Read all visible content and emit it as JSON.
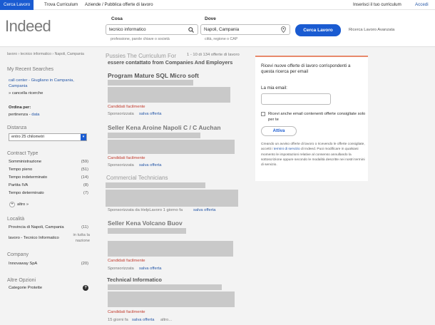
{
  "topnav": {
    "tabs": [
      "Cerca Lavoro",
      "Trova Curriculum",
      "Aziende / Pubblica offerte di lavoro"
    ],
    "insert_cv": "Inserisci il tuo curriculum",
    "login": "Accedi"
  },
  "header": {
    "logo": "Indeed",
    "what_label": "Cosa",
    "what_value": "tecnico informatico",
    "what_hint": "professione, parole chiave o società",
    "where_label": "Dove",
    "where_value": "Napoli, Campania",
    "where_hint": "città, regione o CAP",
    "find_button": "Cerca Lavoro",
    "advanced": "Ricerca Lavoro Avanzata"
  },
  "breadcrumb": "lavoro › tecnico informatico › Napoli, Campania",
  "sidebar": {
    "recent_title": "My Recent Searches",
    "recent_item": "call center - Giugliano in Campania, Campania",
    "clear": "» cancella ricerche",
    "sort_label": "Ordina per:",
    "sort_active": "pertinenza",
    "sort_sep": " - ",
    "sort_other": "data",
    "distance_title": "Distanza",
    "distance_value": "entro 25 chilometri",
    "contract_title": "Contract Type",
    "contract_items": [
      {
        "label": "Somministrazione",
        "count": "(59)"
      },
      {
        "label": "Tempo pieno",
        "count": "(51)"
      },
      {
        "label": "Tempo indeterminato",
        "count": "(14)"
      },
      {
        "label": "Partita IVA",
        "count": "(8)"
      },
      {
        "label": "Tempo determinato",
        "count": "(7)"
      }
    ],
    "more": "altro »",
    "location_title": "Località",
    "location_item": "Provincia di Napoli, Campania",
    "location_count": "(11)",
    "location_sub": "lavoro - Tecnico Informatico",
    "location_sub2": "in tutta la nazione",
    "company_title": "Company",
    "company_item": "Innovaway SpA",
    "company_count": "(20)",
    "other_title": "Altre Opzioni",
    "protected": "Categorie Protette"
  },
  "results": {
    "overlay_title": "Pussies The Curriculum For",
    "count": "1 - 10 di 134 offerte di lavoro",
    "overlay_sub": "essere contattato from Companies And Employers",
    "easy_apply": "Candidati facilmente",
    "sponsored": "Sponsorizzata",
    "save": "salva offerta",
    "jobs": [
      {
        "title": "Program Mature SQL Micro soft"
      },
      {
        "title": "Seller Kena Aroine Napoli C / C Auchan"
      },
      {
        "title": "Commercial Technicians",
        "meta": "Sponsorizzata da HelpLavoro  1 giorno fa"
      },
      {
        "title": "Seller Kena Volcano Buov"
      },
      {
        "title": "Technical Informatico",
        "meta": "15 giorni fa",
        "more": "altro..."
      }
    ]
  },
  "alert": {
    "title": "Ricevi nuove offerte di lavoro corrispondenti a questa ricerca per email",
    "email_label": "La mia email:",
    "checkbox_text": "Ricevi anche email contenenti offerte consigliate solo per te",
    "button": "Attiva",
    "legal_start": "Creando un avviso offerte di lavoro o ricevendo le offerte consigliate, accetti i",
    "legal_link": "termini di servizio",
    "legal_end": "di Indeed. Puoi modificare in qualsiasi momento le impostazioni relative al consenso annullando la sottoscrizione oppure secondo le modalità descritte nei nostri termini di servizio."
  },
  "colors": {
    "primary": "#1a5bd1",
    "link": "#2557a7",
    "easy_apply": "#c0392b",
    "alert_accent": "#e8896b"
  }
}
